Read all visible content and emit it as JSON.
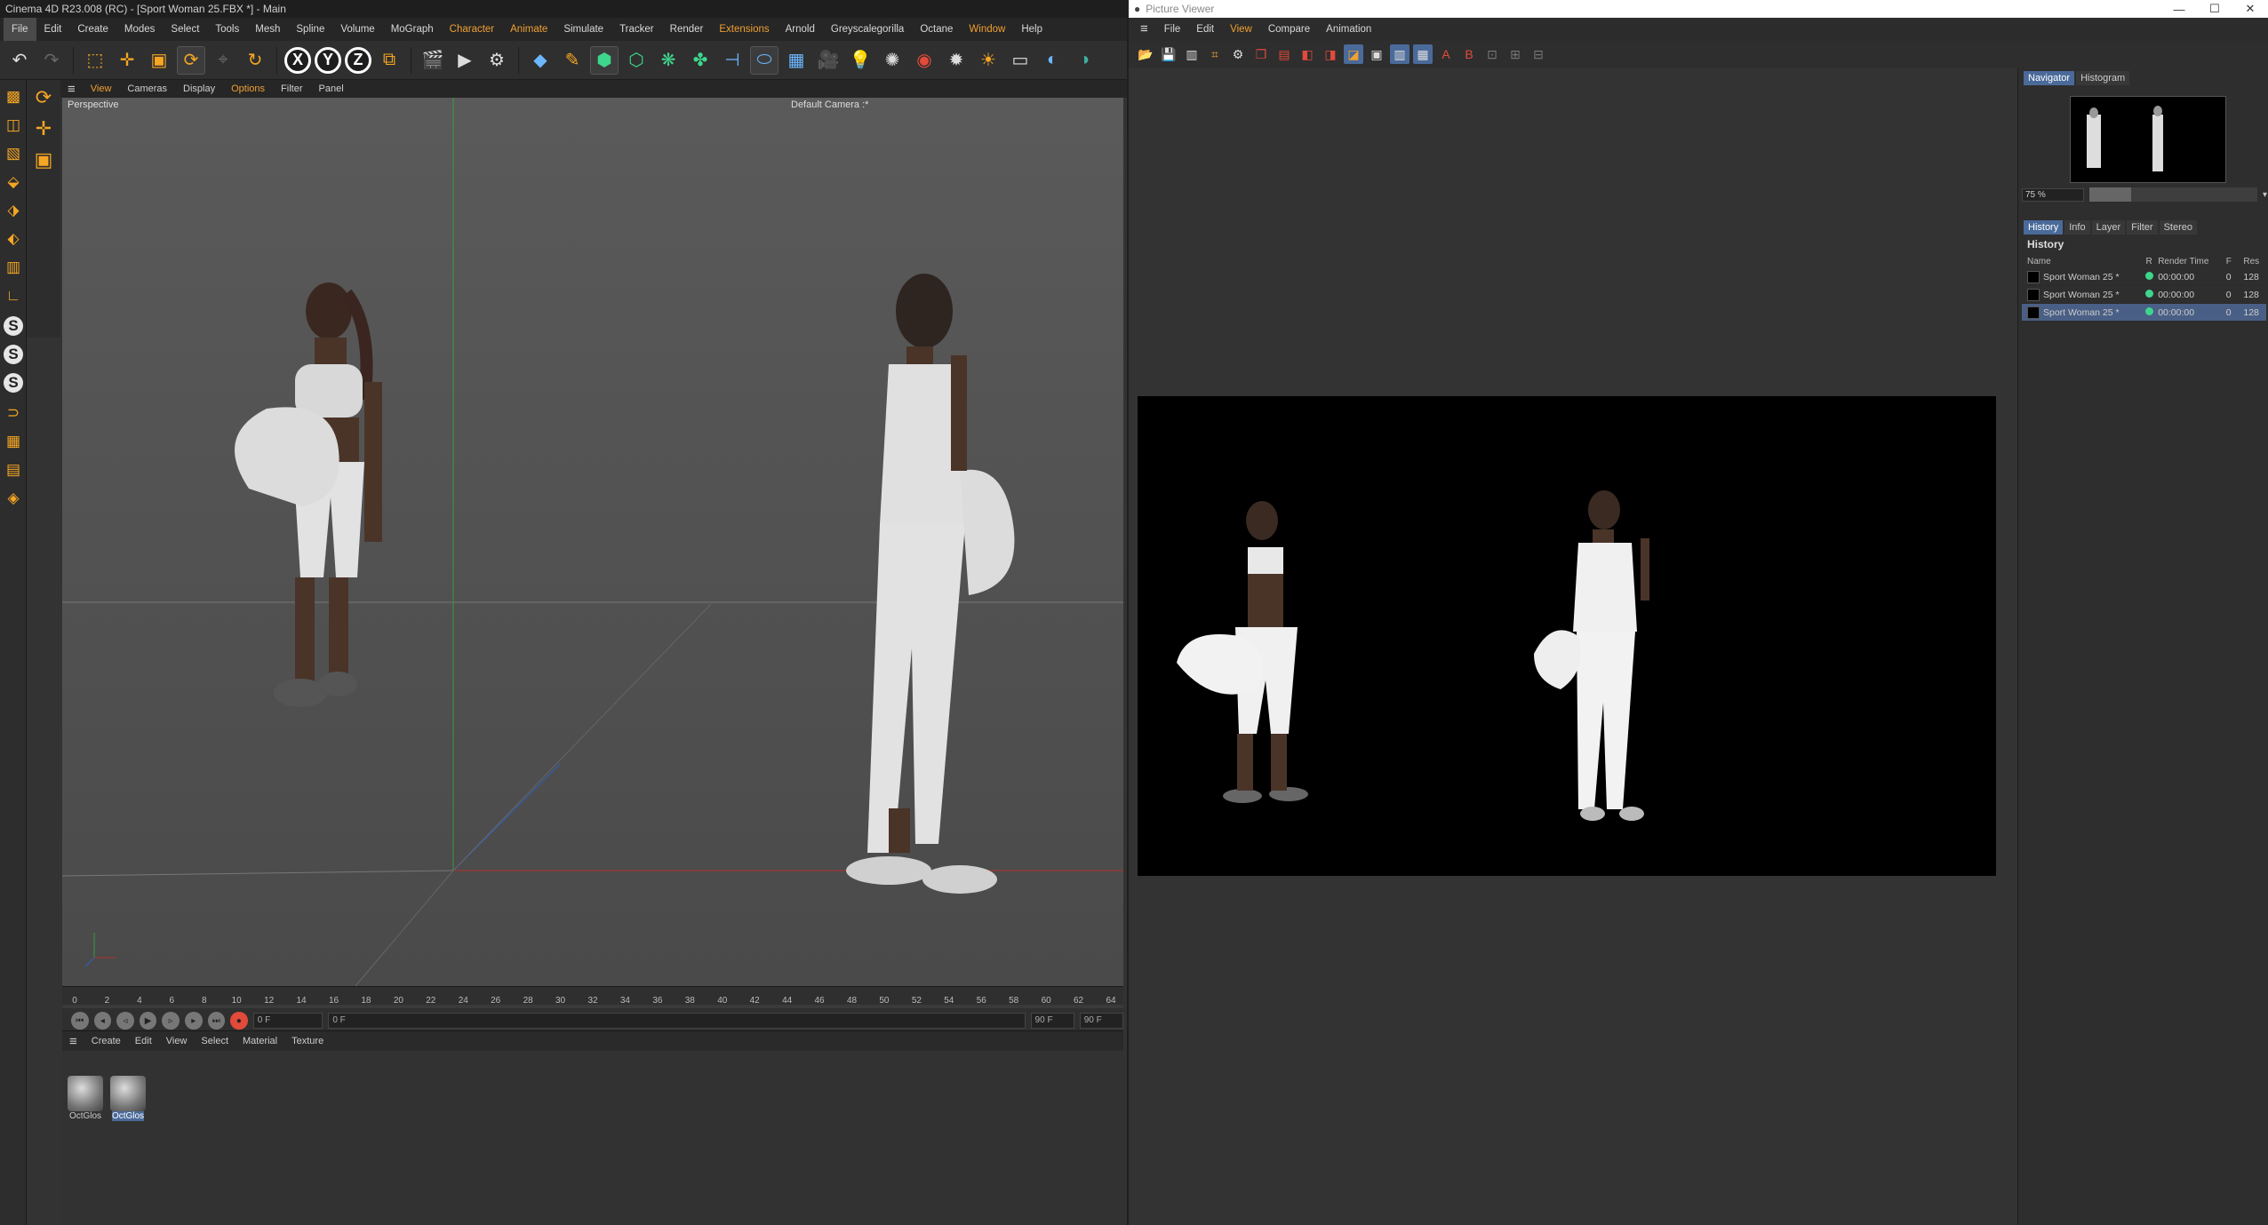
{
  "c4d": {
    "title": "Cinema 4D R23.008 (RC) - [Sport Woman 25.FBX *] - Main",
    "menu": [
      "File",
      "Edit",
      "Create",
      "Modes",
      "Select",
      "Tools",
      "Mesh",
      "Spline",
      "Volume",
      "MoGraph",
      "Character",
      "Animate",
      "Simulate",
      "Tracker",
      "Render",
      "Extensions",
      "Arnold",
      "Greyscalegorilla",
      "Octane",
      "Window",
      "Help"
    ],
    "viewport_menu": [
      "View",
      "Cameras",
      "Display",
      "Options",
      "Filter",
      "Panel"
    ],
    "viewport_label": "Perspective",
    "camera_label": "Default Camera :*",
    "timeline_ticks": [
      "0",
      "2",
      "4",
      "6",
      "8",
      "10",
      "12",
      "14",
      "16",
      "18",
      "20",
      "22",
      "24",
      "26",
      "28",
      "30",
      "32",
      "34",
      "36",
      "38",
      "40",
      "42",
      "44",
      "46",
      "48",
      "50",
      "52",
      "54",
      "56",
      "58",
      "60",
      "62",
      "64"
    ],
    "current_frame": "0 F",
    "start_frame": "0 F",
    "end_frame": "90 F",
    "end_frame2": "90 F",
    "material_menu": [
      "Create",
      "Edit",
      "View",
      "Select",
      "Material",
      "Texture"
    ],
    "materials": [
      "OctGlos",
      "OctGlos"
    ]
  },
  "pv": {
    "title": "Picture Viewer",
    "menu": [
      "File",
      "Edit",
      "View",
      "Compare",
      "Animation"
    ],
    "side_tabs": [
      "Navigator",
      "Histogram"
    ],
    "zoom": "75 %",
    "zoom_level": 0.25,
    "history_tabs": [
      "History",
      "Info",
      "Layer",
      "Filter",
      "Stereo"
    ],
    "history_title": "History",
    "history_headers": [
      "Name",
      "R",
      "Render Time",
      "F",
      "Res"
    ],
    "history_rows": [
      {
        "name": "Sport Woman 25 *",
        "time": "00:00:00",
        "f": "0",
        "res": "128"
      },
      {
        "name": "Sport Woman 25 *",
        "time": "00:00:00",
        "f": "0",
        "res": "128"
      },
      {
        "name": "Sport Woman 25 *",
        "time": "00:00:00",
        "f": "0",
        "res": "128"
      }
    ]
  },
  "colors": {
    "accent": "#f5a623",
    "selection": "#4a6a9a",
    "status_green": "#3dd68c"
  }
}
